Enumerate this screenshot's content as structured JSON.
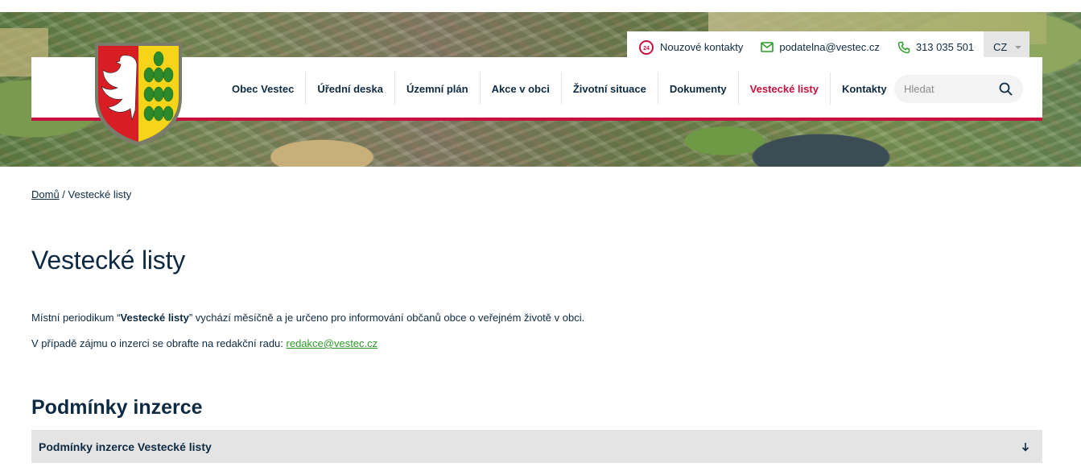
{
  "topbar": {
    "emergency_label": "Nouzové kontakty",
    "email_label": "podatelna@vestec.cz",
    "phone_label": "313 035 501",
    "language": "CZ"
  },
  "nav": {
    "items": [
      {
        "label": "Obec Vestec"
      },
      {
        "label": "Úřední deska"
      },
      {
        "label": "Územní plán"
      },
      {
        "label": "Akce v obci"
      },
      {
        "label": "Životní situace"
      },
      {
        "label": "Dokumenty"
      },
      {
        "label": "Vestecké listy",
        "active": true
      },
      {
        "label": "Kontakty"
      }
    ]
  },
  "search": {
    "placeholder": "Hledat"
  },
  "breadcrumb": {
    "home": "Domů",
    "separator": " / ",
    "current": "Vestecké listy"
  },
  "page": {
    "title": "Vestecké listy",
    "intro_prefix": "Místní periodikum “",
    "intro_bold": "Vestecké listy",
    "intro_suffix": "” vychází měsíčně a je určeno pro informování občanů obce o veřejném životě v obci.",
    "contact_prefix": "V případě zájmu o inzerci se obrafte na redakční radu: ",
    "contact_email": "redakce@vestec.cz"
  },
  "section": {
    "title": "Podmínky inzerce",
    "accordion_label": "Podmínky inzerce Vestecké listy"
  },
  "colors": {
    "accent": "#c8103e",
    "text": "#0d2a42",
    "link_green": "#2d9b27"
  },
  "icons": {
    "emergency": "emergency-24-icon",
    "email": "envelope-icon",
    "phone": "phone-icon",
    "search": "search-icon",
    "accordion": "arrow-down-icon",
    "crest": "vestec-coat-of-arms"
  }
}
